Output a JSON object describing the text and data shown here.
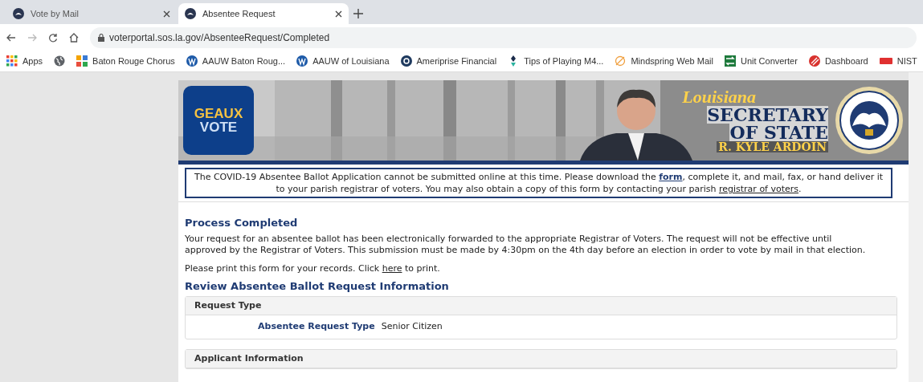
{
  "browser": {
    "tabs": [
      {
        "title": "Vote by Mail",
        "selected": false
      },
      {
        "title": "Absentee Request",
        "selected": true
      }
    ],
    "address": "voterportal.sos.la.gov/AbsenteeRequest/Completed",
    "bookmarks": [
      {
        "kind": "apps",
        "label": "Apps"
      },
      {
        "kind": "globe"
      },
      {
        "kind": "chorus",
        "label": "Baton Rouge Chorus"
      },
      {
        "kind": "aauw",
        "label": "AAUW Baton Roug..."
      },
      {
        "kind": "aauw",
        "label": "AAUW of Louisiana"
      },
      {
        "kind": "ameriprise",
        "label": "Ameriprise Financial"
      },
      {
        "kind": "tips",
        "label": "Tips of Playing M4..."
      },
      {
        "kind": "mindspring",
        "label": "Mindspring Web Mail"
      },
      {
        "kind": "converter",
        "label": "Unit Converter"
      },
      {
        "kind": "dashboard",
        "label": "Dashboard"
      },
      {
        "kind": "nist",
        "label": "NIST"
      }
    ]
  },
  "banner": {
    "logo": [
      "GEAUX",
      "VOTE"
    ],
    "script": "Louisiana",
    "title": [
      "SECRETARY",
      "OF STATE"
    ],
    "name": "R. KYLE ARDOIN"
  },
  "notice": {
    "text_1": "The COVID-19 Absentee Ballot Application cannot be submitted online at this time. Please download the ",
    "form_link": "form",
    "text_2": ", complete it, and mail, fax, or hand deliver it to your parish registrar of voters. You may also obtain a copy of this form by contacting your parish ",
    "registrar_link": "registrar of voters",
    "text_3": "."
  },
  "content": {
    "heading": "Process Completed",
    "message": "Your request for an absentee ballot has been electronically forwarded to the appropriate Registrar of Voters. The request will not be effective until approved by the Registrar of Voters. This submission must be made by 4:30pm on the 4th day before an election in order to vote by mail in that election.",
    "print_before": "Please print this form for your records. Click ",
    "print_link": "here",
    "print_after": " to print.",
    "review_heading": "Review Absentee Ballot Request Information",
    "sections": [
      {
        "title": "Request Type",
        "fields": [
          {
            "label": "Absentee Request Type",
            "value": "Senior Citizen"
          }
        ]
      },
      {
        "title": "Applicant Information"
      }
    ]
  }
}
